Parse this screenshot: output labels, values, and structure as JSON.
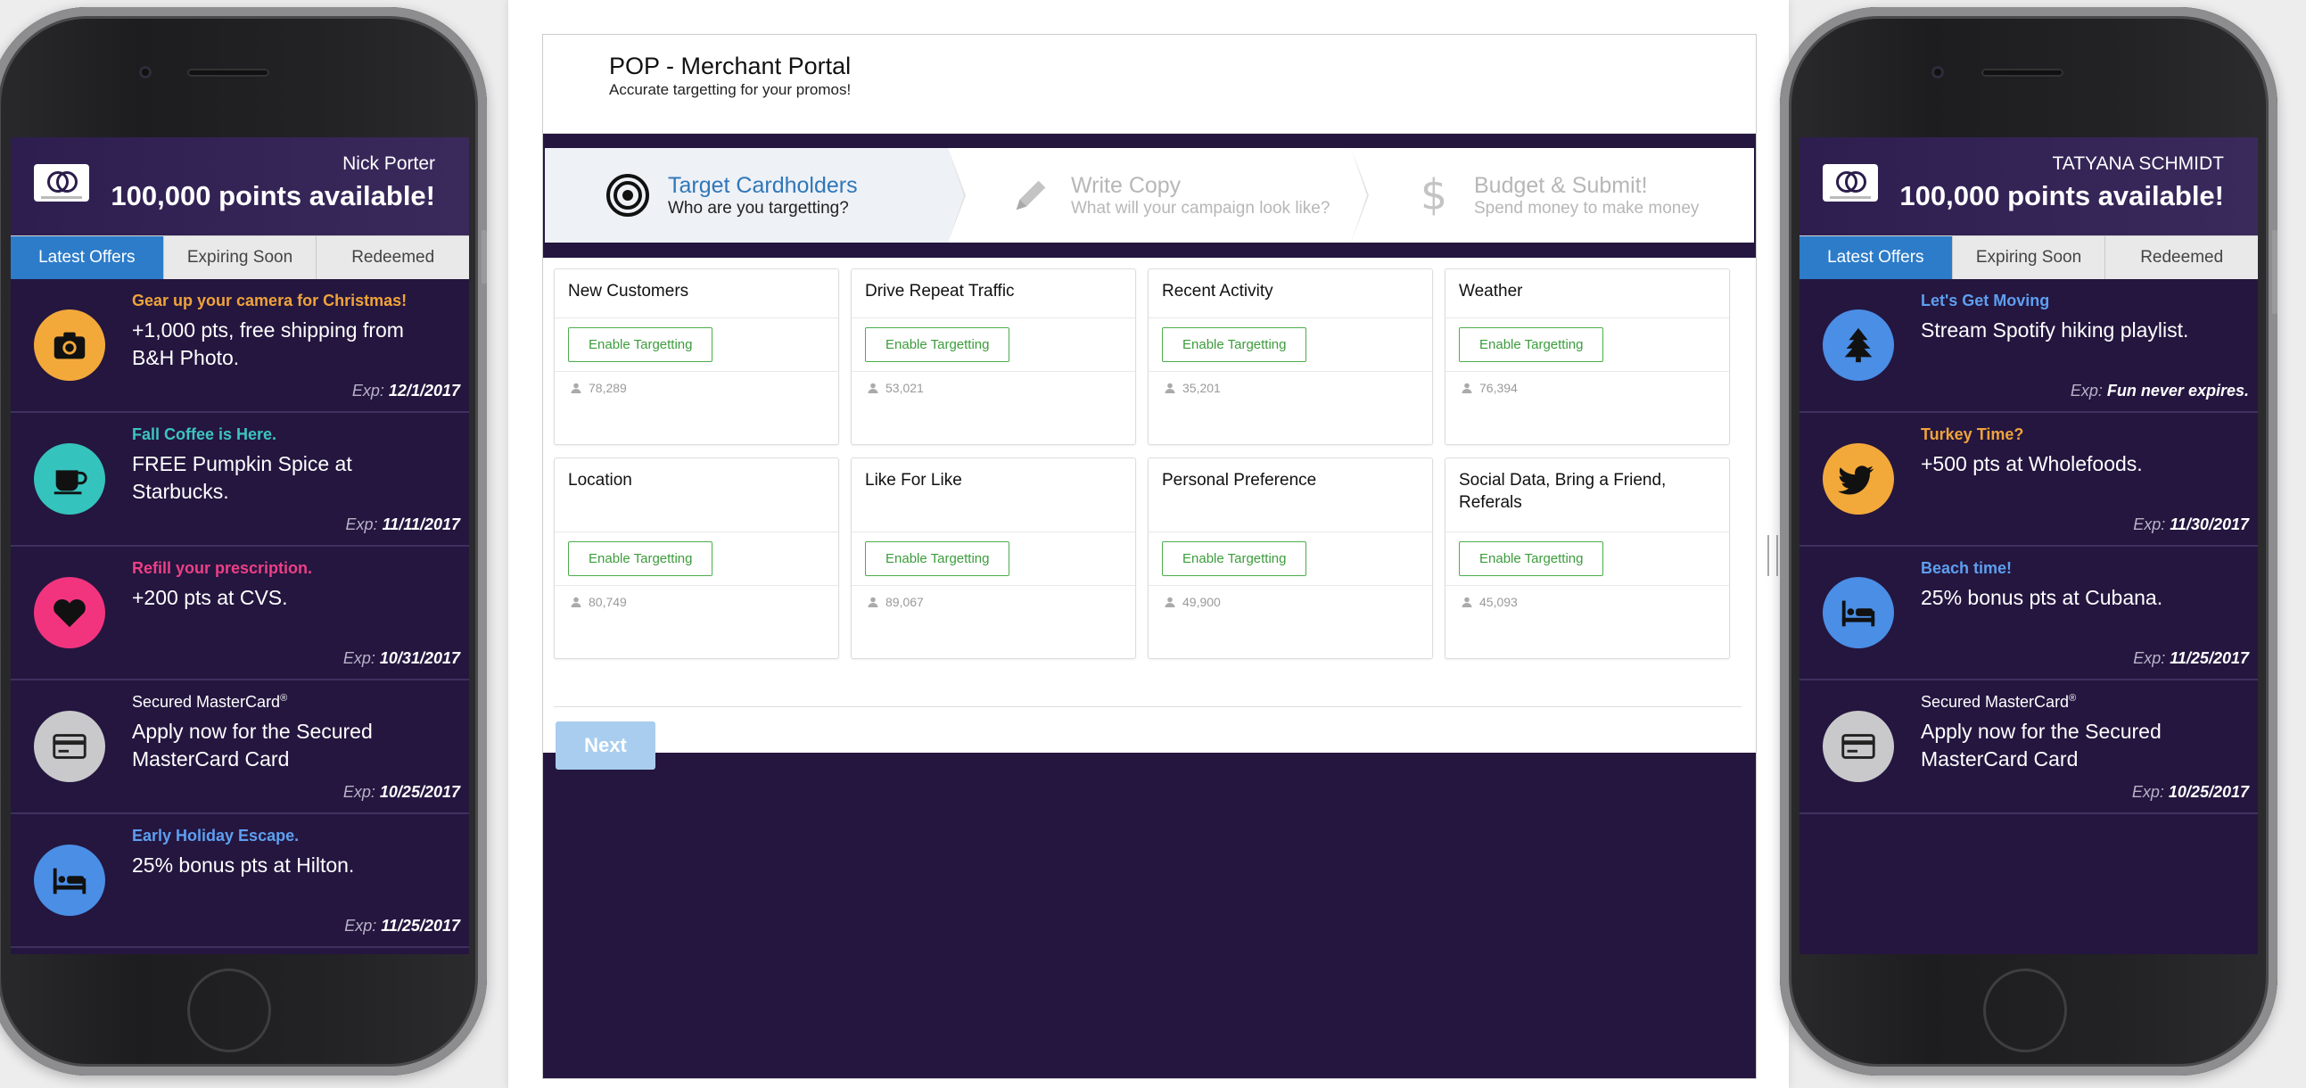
{
  "left_phone": {
    "user_name": "Nick Porter",
    "points": "100,000 points available!",
    "tabs": [
      "Latest Offers",
      "Expiring Soon",
      "Redeemed"
    ],
    "offers": [
      {
        "kicker": "Gear up your camera for Christmas!",
        "kicker_color": "#f0a33a",
        "text": "+1,000 pts, free shipping from B&H Photo.",
        "exp_label": "Exp:",
        "exp": "12/1/2017",
        "icon": "camera-icon",
        "icon_bg": "#f3a93a"
      },
      {
        "kicker": "Fall Coffee is Here.",
        "kicker_color": "#3cc4c0",
        "text": "FREE Pumpkin Spice at Starbucks.",
        "exp_label": "Exp:",
        "exp": "11/11/2017",
        "icon": "coffee-cup-icon",
        "icon_bg": "#35c3bd"
      },
      {
        "kicker": "Refill your prescription.",
        "kicker_color": "#ee3f86",
        "text": "+200 pts at CVS.",
        "exp_label": "Exp:",
        "exp": "10/31/2017",
        "icon": "heart-icon",
        "icon_bg": "#f2347f"
      },
      {
        "kicker": "Secured MasterCard",
        "kicker_sup": "®",
        "text": "Apply now for the Secured MasterCard Card",
        "exp_label": "Exp:",
        "exp": "10/25/2017",
        "icon": "credit-card-icon",
        "icon_bg": "#c9c9cb"
      },
      {
        "kicker": "Early Holiday Escape.",
        "kicker_color": "#5e9ff0",
        "text": "25% bonus pts at Hilton.",
        "exp_label": "Exp:",
        "exp": "11/25/2017",
        "icon": "bed-icon",
        "icon_bg": "#4a8ee6"
      }
    ]
  },
  "right_phone": {
    "user_name": "TATYANA SCHMIDT",
    "points": "100,000 points available!",
    "tabs": [
      "Latest Offers",
      "Expiring Soon",
      "Redeemed"
    ],
    "offers": [
      {
        "kicker": "Let's Get Moving",
        "kicker_color": "#5e9ff0",
        "text": "Stream Spotify hiking playlist.",
        "exp_label": "Exp:",
        "exp": "Fun never expires.",
        "icon": "pine-tree-icon",
        "icon_bg": "#4a8ee6"
      },
      {
        "kicker": "Turkey Time?",
        "kicker_color": "#f0a33a",
        "text": "+500 pts at Wholefoods.",
        "exp_label": "Exp:",
        "exp": "11/30/2017",
        "icon": "bird-icon",
        "icon_bg": "#f3a93a"
      },
      {
        "kicker": "Beach time!",
        "kicker_color": "#5e9ff0",
        "text": "25% bonus pts at Cubana.",
        "exp_label": "Exp:",
        "exp": "11/25/2017",
        "icon": "bed-icon",
        "icon_bg": "#4a8ee6"
      },
      {
        "kicker": "Secured MasterCard",
        "kicker_sup": "®",
        "text": "Apply now for the Secured MasterCard Card",
        "exp_label": "Exp:",
        "exp": "10/25/2017",
        "icon": "credit-card-icon",
        "icon_bg": "#c9c9cb"
      }
    ]
  },
  "portal": {
    "title": "POP - Merchant Portal",
    "subtitle": "Accurate targetting for your promos!",
    "steps": [
      {
        "title": "Target Cardholders",
        "desc": "Who are you targetting?",
        "icon": "target-icon",
        "active": true
      },
      {
        "title": "Write Copy",
        "desc": "What will your campaign look like?",
        "icon": "pencil-icon",
        "active": false
      },
      {
        "title": "Budget & Submit!",
        "desc": "Spend money to make money",
        "icon": "dollar-icon",
        "active": false
      }
    ],
    "enable_label": "Enable Targetting",
    "cards": [
      {
        "title": "New Customers",
        "count": "78,289"
      },
      {
        "title": "Drive Repeat Traffic",
        "count": "53,021"
      },
      {
        "title": "Recent Activity",
        "count": "35,201"
      },
      {
        "title": "Weather",
        "count": "76,394"
      },
      {
        "title": "Location",
        "count": "80,749"
      },
      {
        "title": "Like For Like",
        "count": "89,067"
      },
      {
        "title": "Personal Preference",
        "count": "49,900"
      },
      {
        "title": "Social Data, Bring a Friend, Referals",
        "count": "45,093"
      }
    ],
    "next_label": "Next"
  },
  "colors": {
    "brand_purple": "#24163f",
    "tab_active": "#2d7cc9",
    "step_active": "#2f77b9",
    "enable_green": "#4cae4c",
    "next_disabled": "#a9cdee"
  }
}
